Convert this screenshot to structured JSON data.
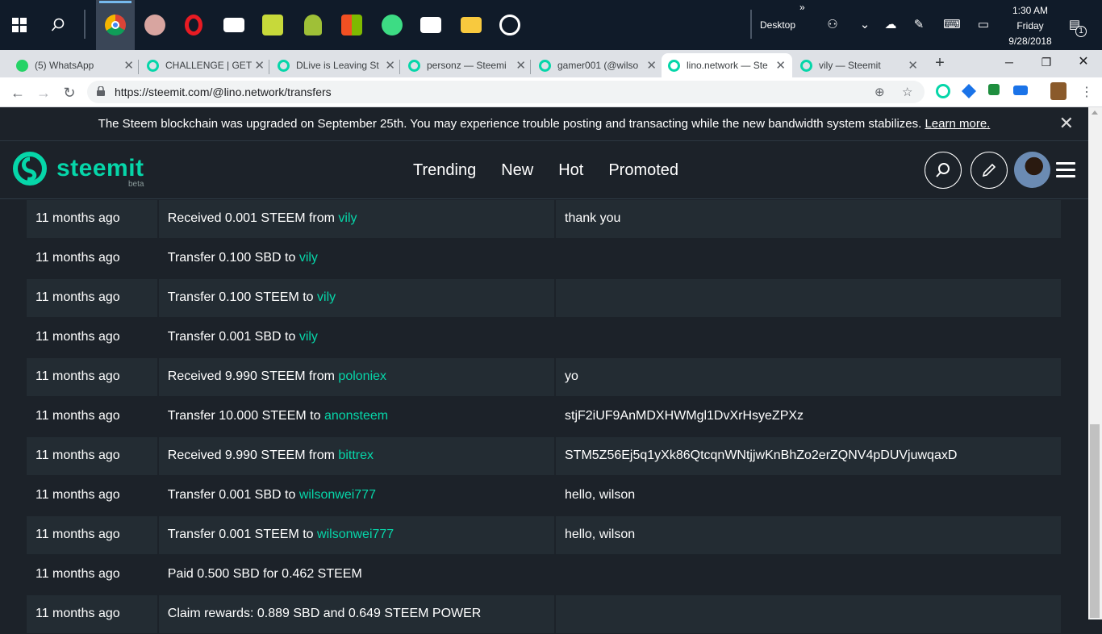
{
  "taskbar": {
    "desktop_label": "Desktop",
    "time": "1:30 AM",
    "day": "Friday",
    "date": "9/28/2018",
    "notification_count": "1",
    "chevrons": "»"
  },
  "tabs": [
    {
      "title": "(5) WhatsApp"
    },
    {
      "title": "CHALLENGE | GET"
    },
    {
      "title": "DLive is Leaving St"
    },
    {
      "title": "personz — Steemi"
    },
    {
      "title": "gamer001 (@wilso"
    },
    {
      "title": "lino.network — Ste"
    },
    {
      "title": "vily — Steemit"
    }
  ],
  "browser": {
    "url": "https://steemit.com/@lino.network/transfers"
  },
  "banner": {
    "text": "The Steem blockchain was upgraded on September 25th. You may experience trouble posting and transacting while the new bandwidth system stabilizes.",
    "link": "Learn more."
  },
  "header": {
    "logo": "steemit",
    "beta": "beta",
    "nav": [
      "Trending",
      "New",
      "Hot",
      "Promoted"
    ]
  },
  "transfers": [
    {
      "time": "11 months ago",
      "desc": "Received 0.001 STEEM from",
      "user": "vily",
      "memo": "thank you"
    },
    {
      "time": "11 months ago",
      "desc": "Transfer 0.100 SBD to",
      "user": "vily",
      "memo": ""
    },
    {
      "time": "11 months ago",
      "desc": "Transfer 0.100 STEEM to",
      "user": "vily",
      "memo": ""
    },
    {
      "time": "11 months ago",
      "desc": "Transfer 0.001 SBD to",
      "user": "vily",
      "memo": ""
    },
    {
      "time": "11 months ago",
      "desc": "Received 9.990 STEEM from",
      "user": "poloniex",
      "memo": "yo"
    },
    {
      "time": "11 months ago",
      "desc": "Transfer 10.000 STEEM to",
      "user": "anonsteem",
      "memo": "stjF2iUF9AnMDXHWMgl1DvXrHsyeZPXz"
    },
    {
      "time": "11 months ago",
      "desc": "Received 9.990 STEEM from",
      "user": "bittrex",
      "memo": "STM5Z56Ej5q1yXk86QtcqnWNtjjwKnBhZo2erZQNV4pDUVjuwqaxD"
    },
    {
      "time": "11 months ago",
      "desc": "Transfer 0.001 SBD to",
      "user": "wilsonwei777",
      "memo": "hello, wilson"
    },
    {
      "time": "11 months ago",
      "desc": "Transfer 0.001 STEEM to",
      "user": "wilsonwei777",
      "memo": "hello, wilson"
    },
    {
      "time": "11 months ago",
      "desc": "Paid 0.500 SBD for 0.462 STEEM",
      "user": "",
      "memo": ""
    },
    {
      "time": "11 months ago",
      "desc": "Claim rewards: 0.889 SBD and 0.649 STEEM POWER",
      "user": "",
      "memo": ""
    }
  ],
  "colors": {
    "accent": "#06d6a9",
    "background": "#1c2229",
    "row_alt": "#232c33"
  }
}
